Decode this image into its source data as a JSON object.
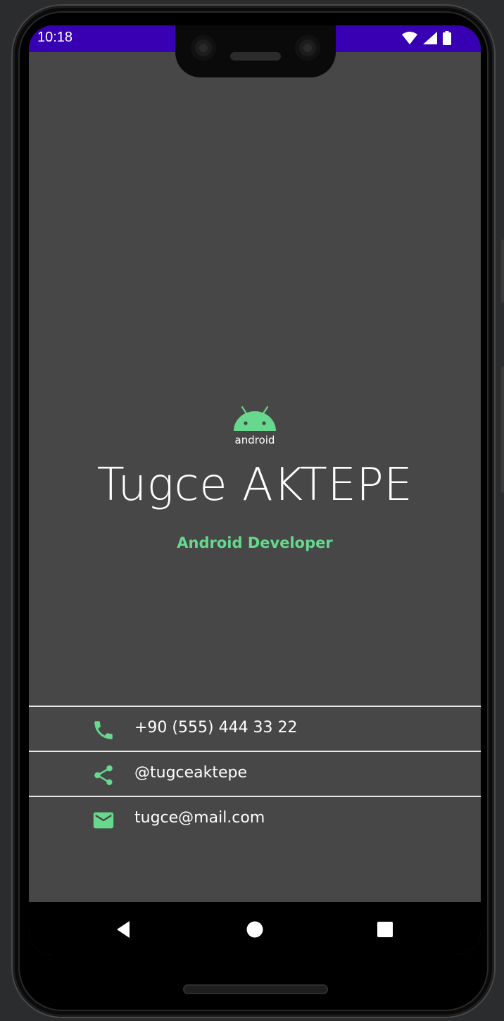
{
  "status_bar": {
    "time": "10:18",
    "icons": [
      "wifi-icon",
      "cell-signal-icon",
      "battery-icon"
    ],
    "background_color": "#3700b3"
  },
  "profile": {
    "logo_icon": "android-logo",
    "logo_text": "android",
    "name": "Tugce AKTEPE",
    "title": "Android Developer"
  },
  "contacts": [
    {
      "icon": "phone-icon",
      "text": "+90 (555) 444 33 22"
    },
    {
      "icon": "share-icon",
      "text": "@tugceaktepe"
    },
    {
      "icon": "email-icon",
      "text": "tugce@mail.com"
    }
  ],
  "navigation": {
    "buttons": [
      "back-icon",
      "home-icon",
      "recents-icon"
    ]
  },
  "colors": {
    "accent": "#67d88e",
    "background": "#474747",
    "text": "#ffffff"
  }
}
